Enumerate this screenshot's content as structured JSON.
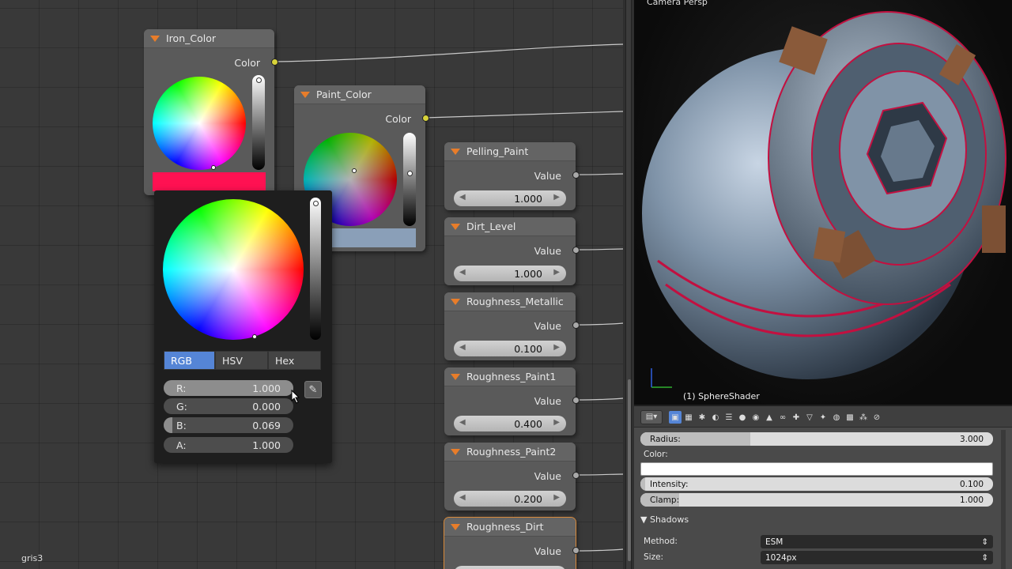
{
  "nodes": [
    {
      "title": "Iron_Color",
      "output": "Color"
    },
    {
      "title": "Paint_Color",
      "output": "Color"
    },
    {
      "title": "Pelling_Paint",
      "output": "Value",
      "value": "1.000"
    },
    {
      "title": "Dirt_Level",
      "output": "Value",
      "value": "1.000"
    },
    {
      "title": "Roughness_Metallic",
      "output": "Value",
      "value": "0.100"
    },
    {
      "title": "Roughness_Paint1",
      "output": "Value",
      "value": "0.400"
    },
    {
      "title": "Roughness_Paint2",
      "output": "Value",
      "value": "0.200"
    },
    {
      "title": "Roughness_Dirt",
      "output": "Value",
      "value": ""
    }
  ],
  "colors": {
    "iron_swatch": "#ff1152",
    "paint_swatch": "#8a9fb8",
    "socket": "#d8d33a",
    "active_tab": "#5585d6",
    "node_arrow": "#e87d2a"
  },
  "picker": {
    "tabs": [
      "RGB",
      "HSV",
      "Hex"
    ],
    "active_tab": "RGB",
    "channels": [
      {
        "label": "R:",
        "value": "1.000",
        "fraction": 1.0
      },
      {
        "label": "G:",
        "value": "0.000",
        "fraction": 0.0
      },
      {
        "label": "B:",
        "value": "0.069",
        "fraction": 0.069
      },
      {
        "label": "A:",
        "value": "1.000",
        "fraction": 1.0
      }
    ]
  },
  "footer": {
    "material_name": "gris3"
  },
  "viewport": {
    "title": "Camera Persp",
    "object_label": "(1) SphereShader"
  },
  "properties": {
    "radius": {
      "label": "Radius:",
      "value": "3.000"
    },
    "color_label": "Color:",
    "color_value": "#ffffff",
    "intensity": {
      "label": "Intensity:",
      "value": "0.100"
    },
    "clamp": {
      "label": "Clamp:",
      "value": "1.000"
    },
    "shadows_panel": "Shadows",
    "method": {
      "label": "Method:",
      "value": "ESM"
    },
    "size": {
      "label": "Size:",
      "value": "1024px"
    }
  }
}
